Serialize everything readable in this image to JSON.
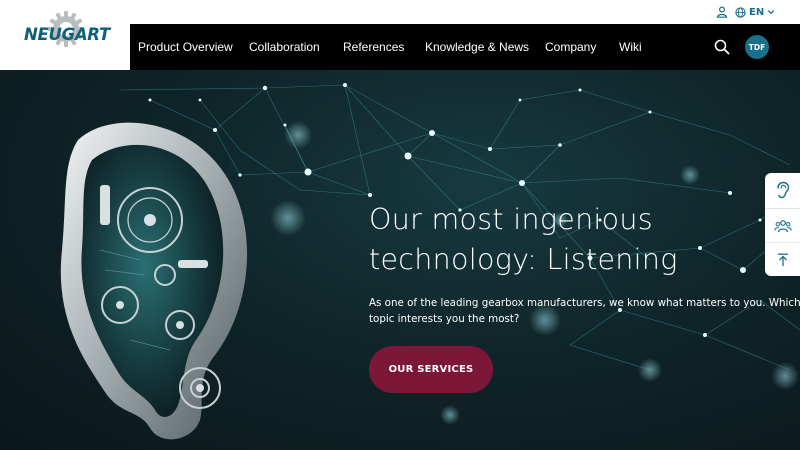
{
  "brand": {
    "name": "NEUGART"
  },
  "utility": {
    "language": "EN",
    "user_icon": "user-icon",
    "globe_icon": "globe-icon",
    "chevron_icon": "chevron-down-icon"
  },
  "nav": {
    "items": [
      {
        "label": "Product Overview"
      },
      {
        "label": "Collaboration"
      },
      {
        "label": "References"
      },
      {
        "label": "Knowledge & News"
      },
      {
        "label": "Company"
      },
      {
        "label": "Wiki"
      }
    ],
    "search_icon": "search-icon",
    "avatar_initials": "TDF"
  },
  "hero": {
    "title_line1": "Our most ingenious",
    "title_line2": "technology: Listening",
    "subtitle_line1": "As one of the leading gearbox manufacturers, we know what matters to you. Which",
    "subtitle_line2": "topic interests you the most?",
    "cta_label": "OUR SERVICES"
  },
  "side_tools": [
    {
      "icon": "ear-icon"
    },
    {
      "icon": "people-icon"
    },
    {
      "icon": "scroll-top-icon"
    }
  ],
  "colors": {
    "brand_teal": "#1a6f8a",
    "cta_burgundy": "#7d1738",
    "nav_bg": "#000000",
    "hero_bg": "#0f2529"
  }
}
